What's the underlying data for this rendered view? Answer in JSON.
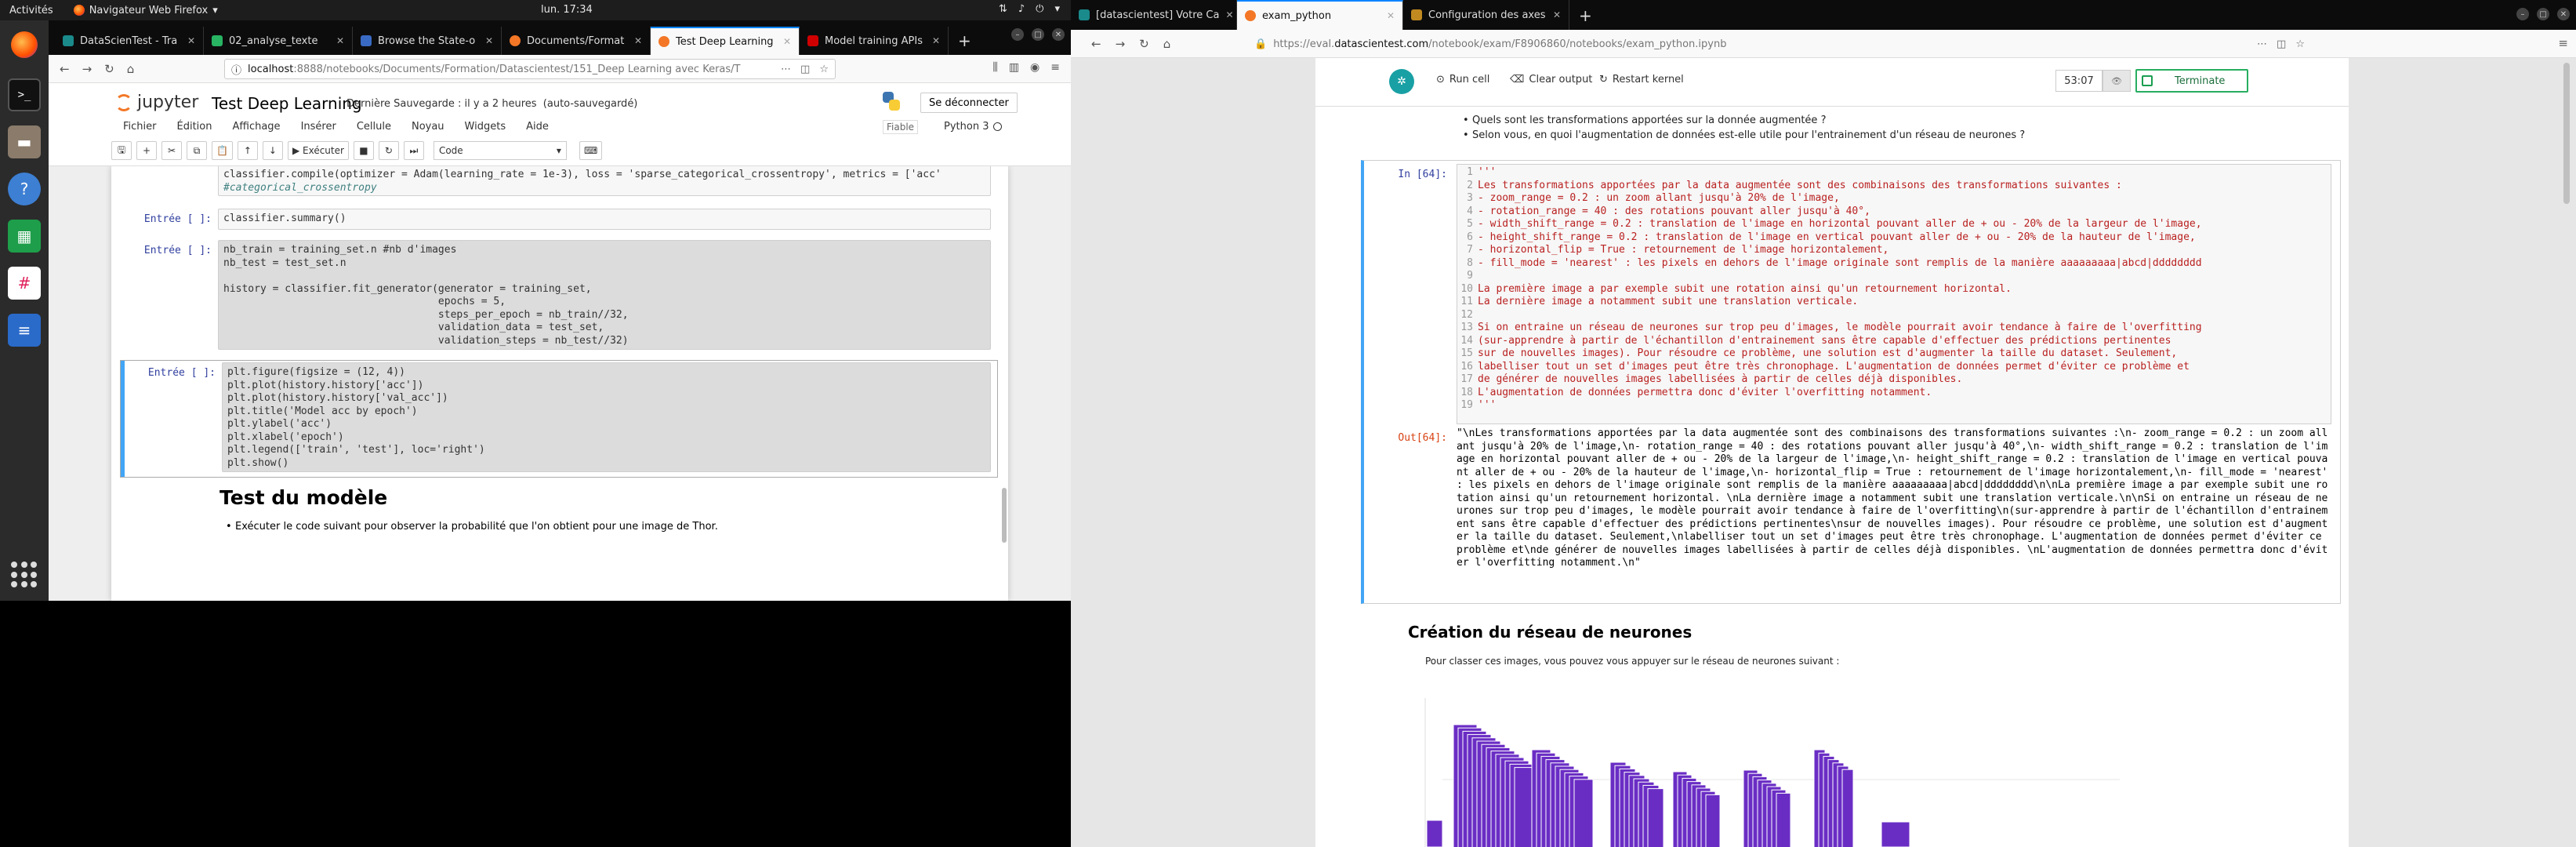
{
  "topbar": {
    "activities": "Activités",
    "app": "Navigateur Web Firefox",
    "clock": "lun. 17:34"
  },
  "left": {
    "tabs": [
      "DataScienTest - Tra",
      "02_analyse_texte",
      "Browse the State-o",
      "Documents/Format",
      "Test Deep Learning",
      "Model training APIs"
    ],
    "url_host": "localhost",
    "url_path": ":8888/notebooks/Documents/Formation/Datascientest/151_Deep Learning avec Keras/T",
    "jupyter": {
      "logo": "jupyter",
      "title": "Test Deep Learning",
      "save_status": "Dernière Sauvegarde : il y a 2 heures",
      "autosave": "(auto-sauvegardé)",
      "disconnect": "Se déconnecter",
      "menu": [
        "Fichier",
        "Édition",
        "Affichage",
        "Insérer",
        "Cellule",
        "Noyau",
        "Widgets",
        "Aide"
      ],
      "trusted": "Fiable",
      "kernel": "Python 3",
      "run": "Exécuter",
      "cell_type": "Code"
    },
    "cells": [
      {
        "prompt": "",
        "lines": [
          "classifier.compile(optimizer = Adam(learning_rate = 1e-3), loss = 'sparse_categorical_crossentropy', metrics = ['acc'",
          "#categorical_crossentropy"
        ]
      },
      {
        "prompt": "Entrée [ ]:",
        "lines": [
          "classifier.summary()"
        ]
      },
      {
        "prompt": "Entrée [ ]:",
        "lines": [
          "nb_train = training_set.n #nb d'images",
          "nb_test = test_set.n",
          "",
          "history = classifier.fit_generator(generator = training_set,",
          "                                   epochs = 5,",
          "                                   steps_per_epoch = nb_train//32,",
          "                                   validation_data = test_set,",
          "                                   validation_steps = nb_test//32)"
        ]
      },
      {
        "prompt": "Entrée [ ]:",
        "lines": [
          "plt.figure(figsize = (12, 4))",
          "plt.plot(history.history['acc'])",
          "plt.plot(history.history['val_acc'])",
          "plt.title('Model acc by epoch')",
          "plt.ylabel('acc')",
          "plt.xlabel('epoch')",
          "plt.legend(['train', 'test'], loc='right')",
          "plt.show()"
        ]
      }
    ],
    "md_heading": "Test du modèle",
    "md_bullet": "Exécuter le code suivant pour observer la probabilité que l'on obtient pour une image de Thor."
  },
  "right": {
    "tabs": [
      "[datascientest] Votre Ca",
      "exam_python",
      "Configuration des axes"
    ],
    "url_prefix": "https://eval.",
    "url_domain": "datascientest.com",
    "url_path": "/notebook/exam/F8906860/notebooks/exam_python.ipynb",
    "toolbar": {
      "run": "Run cell",
      "clear": "Clear output",
      "restart": "Restart kernel",
      "timer": "53:07",
      "terminate": "Terminate"
    },
    "bullets": [
      "Quels sont les transformations apportées sur la donnée augmentée ?",
      "Selon vous, en quoi l'augmentation de données est-elle utile pour l'entrainement d'un réseau de neurones ?"
    ],
    "in_prompt": "In [64]:",
    "out_prompt": "Out[64]:",
    "code_lines": [
      "'''",
      "Les transformations apportées par la data augmentée sont des combinaisons des transformations suivantes :",
      "- zoom_range = 0.2 : un zoom allant jusqu'à 20% de l'image,",
      "- rotation_range = 40 : des rotations pouvant aller jusqu'à 40°,",
      "- width_shift_range = 0.2 : translation de l'image en horizontal pouvant aller de + ou - 20% de la largeur de l'image,",
      "- height_shift_range = 0.2 : translation de l'image en vertical pouvant aller de + ou - 20% de la hauteur de l'image,",
      "- horizontal_flip = True : retournement de l'image horizontalement,",
      "- fill_mode = 'nearest' : les pixels en dehors de l'image originale sont remplis de la manière aaaaaaaaa|abcd|dddddddd",
      "",
      "La première image a par exemple subit une rotation ainsi qu'un retournement horizontal.",
      "La dernière image a notamment subit une translation verticale.",
      "",
      "Si on entraine un réseau de neurones sur trop peu d'images, le modèle pourrait avoir tendance à faire de l'overfitting",
      "(sur-apprendre à partir de l'échantillon d'entrainement sans être capable d'effectuer des prédictions pertinentes",
      "sur de nouvelles images). Pour résoudre ce problème, une solution est d'augmenter la taille du dataset. Seulement,",
      "labelliser tout un set d'images peut être très chronophage. L'augmentation de données permet d'éviter ce problème et",
      "de générer de nouvelles images labellisées à partir de celles déjà disponibles.",
      "L'augmentation de données permettra donc d'éviter l'overfitting notamment.",
      "'''"
    ],
    "output": "\"\\nLes transformations apportées par la data augmentée sont des combinaisons des transformations suivantes :\\n- zoom_range = 0.2 : un zoom allant jusqu'à 20% de l'image,\\n- rotation_range = 40 : des rotations pouvant aller jusqu'à 40°,\\n- width_shift_range = 0.2 : translation de l'image en horizontal pouvant aller de + ou - 20% de la largeur de l'image,\\n- height_shift_range = 0.2 : translation de l'image en vertical pouvant aller de + ou - 20% de la hauteur de l'image,\\n- horizontal_flip = True : retournement de l'image horizontalement,\\n- fill_mode = 'nearest' : les pixels en dehors de l'image originale sont remplis de la manière aaaaaaaaa|abcd|dddddddd\\n\\nLa première image a par exemple subit une rotation ainsi qu'un retournement horizontal. \\nLa dernière image a notamment subit une translation verticale.\\n\\nSi on entraine un réseau de neurones sur trop peu d'images, le modèle pourrait avoir tendance à faire de l'overfitting\\n(sur-apprendre à partir de l'échantillon d'entrainement sans être capable d'effectuer des prédictions pertinentes\\nsur de nouvelles images). Pour résoudre ce problème, une solution est d'augmenter la taille du dataset. Seulement,\\nlabelliser tout un set d'images peut être très chronophage. L'augmentation de données permet d'éviter ce problème et\\nde générer de nouvelles images labellisées à partir de celles déjà disponibles. \\nL'augmentation de données permettra donc d'éviter l'overfitting notamment.\\n\"",
    "section_title": "Création du réseau de neurones",
    "section_text": "Pour classer ces images, vous pouvez vous appuyer sur le réseau de neurones suivant :"
  },
  "colors": {
    "accent": "#0a84ff",
    "cell_selected": "#42a5f5",
    "string": "#ba2121",
    "network": "#6a2dc4",
    "terminate": "#27ae60"
  }
}
